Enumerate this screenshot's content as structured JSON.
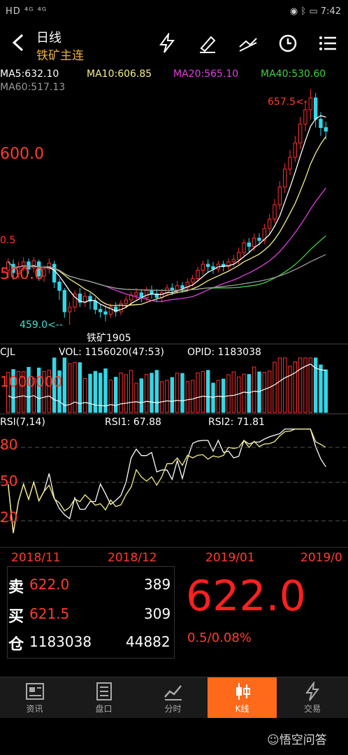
{
  "status": {
    "left": "HD ⁴ᴳ ⁴ᴳ",
    "time": "7:42"
  },
  "header": {
    "period": "日线",
    "contract": "铁矿主连"
  },
  "ma": {
    "ma5": "MA5:632.10",
    "ma10": "MA10:606.85",
    "ma20": "MA20:565.10",
    "ma40": "MA40:530.60",
    "ma60": "MA60:517.13",
    "colors": {
      "ma5": "#ffffff",
      "ma10": "#f5f08a",
      "ma20": "#e040e0",
      "ma40": "#40d040",
      "ma60": "#999999"
    }
  },
  "price_chart": {
    "high_label": "657.5<-",
    "low_label": "459.0<--",
    "level_600": "600.0",
    "level_500": "500.0",
    "left_top": "0.5",
    "contract_label": "铁矿1905"
  },
  "volume": {
    "title": "CJL",
    "vol": "VOL: 1156020(47:53)",
    "opid": "OPID: 1183038",
    "scale": "1000000"
  },
  "rsi": {
    "title": "RSI(7,14)",
    "rsi1": "RSI1: 67.88",
    "rsi2": "RSI2: 71.81",
    "l80": "80",
    "l50": "50",
    "l20": "20"
  },
  "dates": [
    "2018/11",
    "2018/12",
    "2019/01",
    "2019/0"
  ],
  "quote": {
    "sell_label": "卖",
    "sell_price": "622.0",
    "sell_qty": "389",
    "buy_label": "买",
    "buy_price": "621.5",
    "buy_qty": "309",
    "oi_label": "仓",
    "oi_value": "1183038",
    "oi_change": "44882",
    "last": "622.0",
    "change": "0.5/0.08%"
  },
  "nav": [
    {
      "label": "资讯"
    },
    {
      "label": "盘口"
    },
    {
      "label": "分时"
    },
    {
      "label": "K线"
    },
    {
      "label": "交易"
    }
  ],
  "watermark": "悟空问答",
  "chart_data": {
    "type": "candlestick",
    "price_axis_labels": [
      600.0,
      500.0
    ],
    "high": 657.5,
    "low": 459.0,
    "last": 622.0,
    "x_labels": [
      "2018/11",
      "2018/12",
      "2019/01",
      "2019/0"
    ],
    "indicators": {
      "MA5": 632.1,
      "MA10": 606.85,
      "MA20": 565.1,
      "MA40": 530.6,
      "MA60": 517.13,
      "VOL": 1156020,
      "OPID": 1183038,
      "RSI1": 67.88,
      "RSI2": 71.81
    },
    "rsi_levels": [
      80,
      50,
      20
    ],
    "candles": [
      [
        505,
        512,
        498,
        515
      ],
      [
        510,
        503,
        497,
        514
      ],
      [
        502,
        508,
        498,
        512
      ],
      [
        508,
        512,
        504,
        516
      ],
      [
        512,
        506,
        502,
        515
      ],
      [
        507,
        513,
        503,
        516
      ],
      [
        512,
        500,
        496,
        514
      ],
      [
        500,
        506,
        495,
        509
      ],
      [
        506,
        511,
        502,
        515
      ],
      [
        510,
        495,
        490,
        513
      ],
      [
        495,
        488,
        480,
        498
      ],
      [
        488,
        470,
        465,
        490
      ],
      [
        470,
        474,
        459,
        478
      ],
      [
        474,
        485,
        470,
        488
      ],
      [
        485,
        478,
        474,
        490
      ],
      [
        478,
        483,
        474,
        487
      ],
      [
        483,
        479,
        472,
        486
      ],
      [
        479,
        472,
        468,
        482
      ],
      [
        472,
        470,
        465,
        476
      ],
      [
        470,
        468,
        462,
        474
      ],
      [
        468,
        474,
        465,
        477
      ],
      [
        474,
        470,
        466,
        478
      ],
      [
        470,
        477,
        467,
        480
      ],
      [
        477,
        480,
        473,
        483
      ],
      [
        480,
        484,
        476,
        487
      ],
      [
        484,
        486,
        480,
        490
      ],
      [
        486,
        482,
        478,
        489
      ],
      [
        482,
        488,
        479,
        491
      ],
      [
        488,
        485,
        481,
        492
      ],
      [
        485,
        482,
        478,
        489
      ],
      [
        482,
        486,
        478,
        489
      ],
      [
        486,
        490,
        483,
        493
      ],
      [
        490,
        488,
        484,
        494
      ],
      [
        488,
        492,
        485,
        496
      ],
      [
        492,
        490,
        486,
        495
      ],
      [
        490,
        495,
        487,
        498
      ],
      [
        495,
        498,
        491,
        501
      ],
      [
        498,
        505,
        495,
        508
      ],
      [
        505,
        510,
        501,
        513
      ],
      [
        510,
        508,
        503,
        514
      ],
      [
        508,
        506,
        502,
        512
      ],
      [
        506,
        510,
        503,
        513
      ],
      [
        510,
        508,
        504,
        513
      ],
      [
        508,
        512,
        505,
        515
      ],
      [
        512,
        514,
        508,
        518
      ],
      [
        514,
        520,
        510,
        524
      ],
      [
        520,
        528,
        517,
        531
      ],
      [
        528,
        525,
        520,
        532
      ],
      [
        525,
        532,
        521,
        536
      ],
      [
        532,
        530,
        526,
        536
      ],
      [
        530,
        540,
        527,
        544
      ],
      [
        540,
        548,
        536,
        552
      ],
      [
        548,
        560,
        545,
        565
      ],
      [
        560,
        575,
        556,
        580
      ],
      [
        575,
        590,
        570,
        595
      ],
      [
        590,
        600,
        585,
        606
      ],
      [
        600,
        612,
        596,
        618
      ],
      [
        612,
        628,
        607,
        634
      ],
      [
        628,
        640,
        622,
        648
      ],
      [
        640,
        650,
        632,
        657.5
      ],
      [
        650,
        632,
        625,
        654
      ],
      [
        632,
        625,
        618,
        638
      ],
      [
        625,
        622,
        615,
        630
      ]
    ]
  }
}
